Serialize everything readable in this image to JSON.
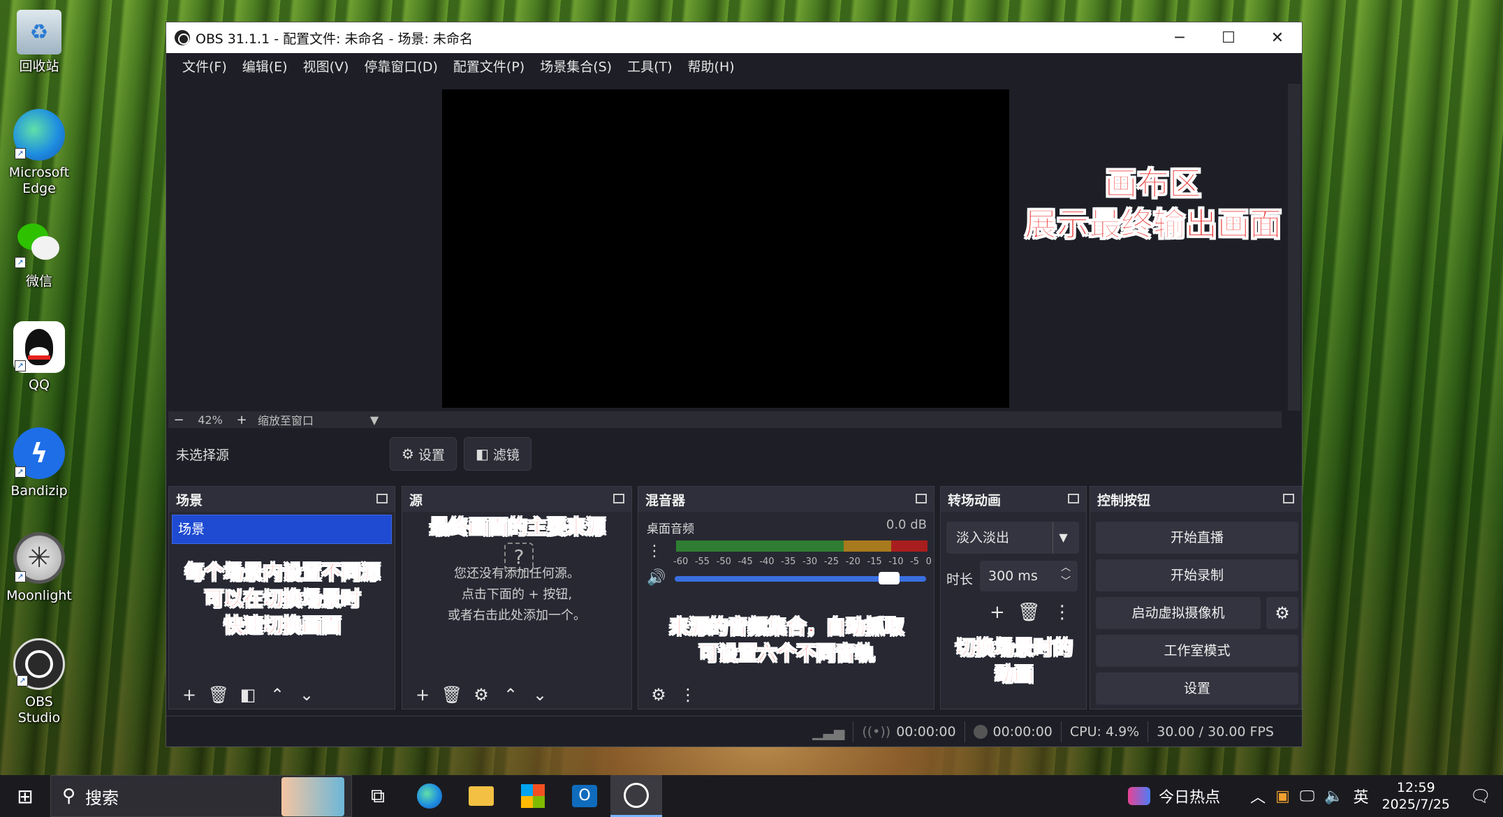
{
  "desktop": {
    "icons": [
      {
        "label": "回收站",
        "icon": "recycle-bin-icon"
      },
      {
        "label": "Microsoft Edge",
        "icon": "edge-icon"
      },
      {
        "label": "微信",
        "icon": "wechat-icon"
      },
      {
        "label": "QQ",
        "icon": "qq-icon"
      },
      {
        "label": "Bandizip",
        "icon": "bandizip-icon"
      },
      {
        "label": "Moonlight",
        "icon": "moonlight-icon"
      },
      {
        "label": "OBS Studio",
        "icon": "obs-icon"
      }
    ]
  },
  "window": {
    "title": "OBS 31.1.1 - 配置文件: 未命名 - 场景: 未命名",
    "minimize": "─",
    "maximize": "☐",
    "close": "✕"
  },
  "menu": [
    "文件(F)",
    "编辑(E)",
    "视图(V)",
    "停靠窗口(D)",
    "配置文件(P)",
    "场景集合(S)",
    "工具(T)",
    "帮助(H)"
  ],
  "zoom": {
    "minus": "−",
    "value": "42%",
    "plus": "+",
    "mode": "缩放至窗口",
    "dropdown": "▼"
  },
  "source_toolbar": {
    "no_selection": "未选择源",
    "settings": "设置",
    "filters": "滤镜"
  },
  "docks": {
    "scenes": {
      "title": "场景",
      "items": [
        "场景"
      ]
    },
    "sources": {
      "title": "源",
      "empty_line1": "您还没有添加任何源。",
      "empty_line2": "点击下面的 + 按钮,",
      "empty_line3": "或者右击此处添加一个。"
    },
    "mixer": {
      "title": "混音器",
      "track": "桌面音频",
      "db": "0.0 dB",
      "scale": [
        "-60",
        "-55",
        "-50",
        "-45",
        "-40",
        "-35",
        "-30",
        "-25",
        "-20",
        "-15",
        "-10",
        "-5",
        "0"
      ],
      "volume": 1.0
    },
    "transitions": {
      "title": "转场动画",
      "selected": "淡入淡出",
      "duration_label": "时长",
      "duration": "300 ms"
    },
    "controls": {
      "title": "控制按钮",
      "buttons": [
        "开始直播",
        "开始录制",
        "启动虚拟摄像机",
        "工作室模式",
        "设置"
      ]
    }
  },
  "annotations": {
    "canvas_title": "画布区",
    "canvas_desc": "展示最终输出画面",
    "scenes_1": "每个场景内设置不同源",
    "scenes_2": "可以在切换场景时",
    "scenes_3": "快速切换画面",
    "sources": "最终画面的主要来源",
    "mixer_1": "来源的音频集合，自动抓取",
    "mixer_2": "可设置六个不同音轨",
    "transitions_1": "切换场景时的",
    "transitions_2": "动画"
  },
  "status": {
    "stream_time": "00:00:00",
    "record_time": "00:00:00",
    "cpu": "CPU: 4.9%",
    "fps": "30.00 / 30.00 FPS"
  },
  "taskbar": {
    "search_placeholder": "搜索",
    "news": "今日热点",
    "ime": "英",
    "time": "12:59",
    "date": "2025/7/25"
  },
  "colors": {
    "accent": "#1e4bd2",
    "annotation": "#e8231e",
    "obs_bg": "#1e1f26"
  }
}
